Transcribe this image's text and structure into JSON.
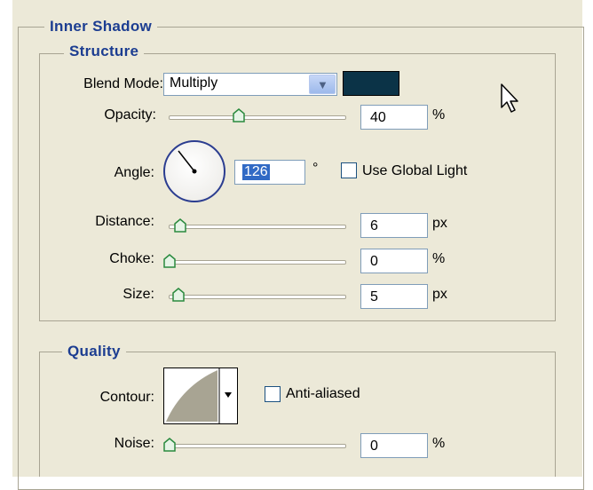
{
  "section": {
    "title": "Inner Shadow"
  },
  "structure": {
    "title": "Structure",
    "blend_mode": {
      "label": "Blend Mode:",
      "value": "Multiply",
      "color": "#0b3347"
    },
    "opacity": {
      "label": "Opacity:",
      "value": "40",
      "unit": "%",
      "level": 0.4
    },
    "angle": {
      "label": "Angle:",
      "value": "126",
      "unit": "°",
      "use_global_light": "Use Global Light",
      "global_light_checked": false
    },
    "distance": {
      "label": "Distance:",
      "value": "6",
      "unit": "px",
      "level": 0.05
    },
    "choke": {
      "label": "Choke:",
      "value": "0",
      "unit": "%",
      "level": 0.0
    },
    "size": {
      "label": "Size:",
      "value": "5",
      "unit": "px",
      "level": 0.05
    }
  },
  "quality": {
    "title": "Quality",
    "contour": {
      "label": "Contour:",
      "anti_aliased": "Anti-aliased",
      "anti_aliased_checked": false
    },
    "noise": {
      "label": "Noise:",
      "value": "0",
      "unit": "%",
      "level": 0.0
    }
  },
  "icons": [
    "dropdown-arrow-icon",
    "slider-thumb-icon",
    "mouse-cursor-icon"
  ]
}
